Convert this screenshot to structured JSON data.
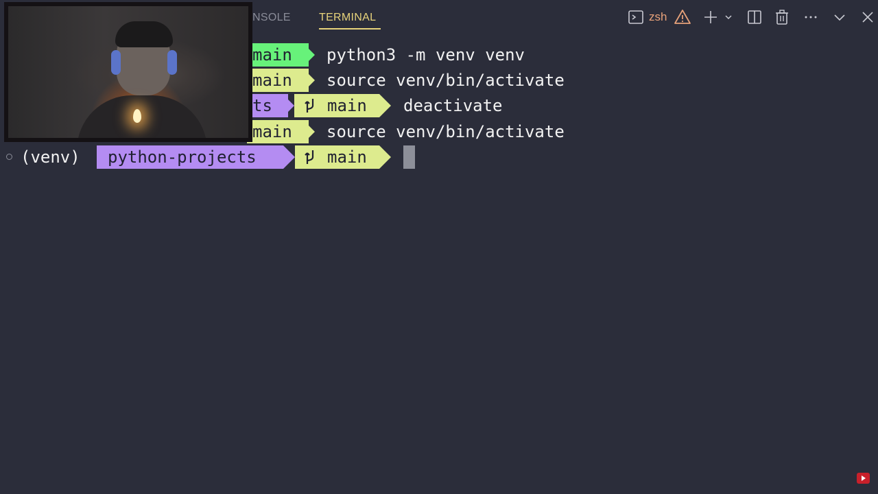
{
  "panel": {
    "tabs": [
      {
        "label": "NSOLE"
      },
      {
        "label": "TERMINAL"
      }
    ],
    "shell_label": "zsh"
  },
  "terminal": {
    "lines": [
      {
        "segments": [
          "main"
        ],
        "command": "python3 -m venv venv"
      },
      {
        "segments": [
          "main"
        ],
        "command": "source venv/bin/activate"
      },
      {
        "segments": [
          "ts",
          "main"
        ],
        "command": "deactivate"
      },
      {
        "segments": [
          "main"
        ],
        "command": "source venv/bin/activate"
      },
      {
        "prefix": "(venv)",
        "segments": [
          "python-projects",
          "main"
        ],
        "command": ""
      }
    ]
  },
  "colors": {
    "background": "#2b2d3a",
    "accent_tab": "#e7d37b",
    "segment_purple": "#b48cf2",
    "segment_green": "#67f27a",
    "segment_yellow": "#ddeb8e",
    "shell_label": "#e8a27a",
    "warning": "#e8a27a"
  },
  "icons": {
    "terminal": "terminal-icon",
    "warning": "warning-icon",
    "add": "plus-icon",
    "dropdown": "chevron-down-icon",
    "split": "split-editor-icon",
    "trash": "trash-icon",
    "more": "more-icon",
    "collapse": "chevron-down-icon",
    "close": "close-icon",
    "branch": "git-branch-icon"
  }
}
